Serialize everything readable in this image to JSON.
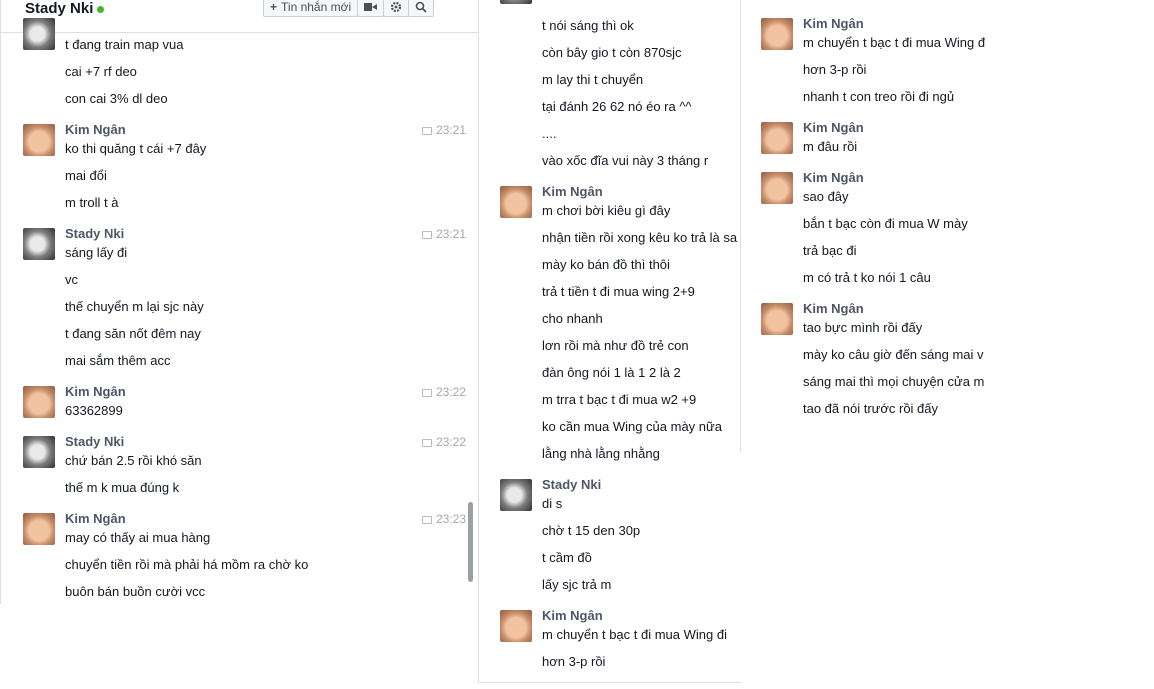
{
  "header": {
    "contact_name": "Stady Nki",
    "new_message_label": "Tin nhắn mới",
    "video_icon": "video-camera-icon",
    "settings_icon": "gear-icon",
    "search_icon": "search-icon",
    "online_status_color": "#42b72a"
  },
  "panel1": {
    "first_group": [
      "t đang train map vua",
      "cai +7 rf deo",
      "con cai 3% dl deo"
    ],
    "groups": [
      {
        "sender": "Kim Ngân",
        "time": "23:21",
        "lines": [
          "ko thi quăng t cái +7 đây",
          "mai đổi",
          "m troll t à"
        ]
      },
      {
        "sender": "Stady Nki",
        "time": "23:21",
        "lines": [
          "sáng lấy đi",
          "vc",
          "thế chuyển m lại sjc này",
          "t đang săn nốt đêm nay",
          "mai sắm thêm acc"
        ]
      },
      {
        "sender": "Kim Ngân",
        "time": "23:22",
        "lines": [
          "63362899"
        ]
      },
      {
        "sender": "Stady Nki",
        "time": "23:22",
        "lines": [
          "chứ bán 2.5 rồi khó săn",
          "thế m k mua đúng k"
        ]
      },
      {
        "sender": "Kim Ngân",
        "time": "23:23",
        "lines": [
          "may có thấy ai mua hàng",
          "chuyển tiền rồi mà phải há mồm ra chờ ko",
          "buôn bán buồn cười vcc"
        ]
      }
    ]
  },
  "panel2": {
    "first_group": [
      "t nói sáng thì ok",
      "còn bây gio t còn 870sjc",
      "m lay thi t chuyển",
      "tại đánh 26 62 nó éo ra ^^",
      "....",
      "vào xốc đĩa vui này 3 tháng r"
    ],
    "groups": [
      {
        "sender": "Kim Ngân",
        "lines": [
          "m chơi bời kiêu gì đây",
          "nhận tiền rồi xong kêu ko trả là sa",
          "mày ko bán đồ thì thôi",
          "trả t tiền t đi mua wing 2+9",
          "cho nhanh",
          "lơn rồi mà như đồ trẻ con",
          "đàn ông nói 1 là 1 2 là 2",
          "m trra t bạc t đi mua w2 +9",
          "ko cần mua Wing của mày nữa",
          "lằng nhà lằng nhằng"
        ]
      },
      {
        "sender": "Stady Nki",
        "lines": [
          "di s",
          "chờ t 15 den 30p",
          "t cầm đồ",
          "lấy sjc trả m"
        ]
      },
      {
        "sender": "Kim Ngân",
        "lines": [
          "m chuyển t bạc t đi mua Wing đi",
          "hơn 3-p rồi"
        ]
      }
    ]
  },
  "panel3": {
    "groups": [
      {
        "sender": "Kim Ngân",
        "lines": [
          "m chuyển t bạc t đi mua Wing đ",
          "hơn 3-p rồi",
          "nhanh t con treo rồi đi ngủ"
        ]
      },
      {
        "sender": "Kim Ngân",
        "lines": [
          "m đâu rồi"
        ]
      },
      {
        "sender": "Kim Ngân",
        "lines": [
          "sao đây",
          "bắn t bạc còn đi mua W mày",
          "trả bạc đi",
          "m có trả t ko nói 1 câu"
        ]
      },
      {
        "sender": "Kim Ngân",
        "lines": [
          "tao bực mình rồi đấy",
          "mày ko câu giờ đến sáng mai v",
          "sáng mai thì mọi chuyện cửa m",
          "tao đã nói trước rồi đấy"
        ]
      }
    ]
  }
}
